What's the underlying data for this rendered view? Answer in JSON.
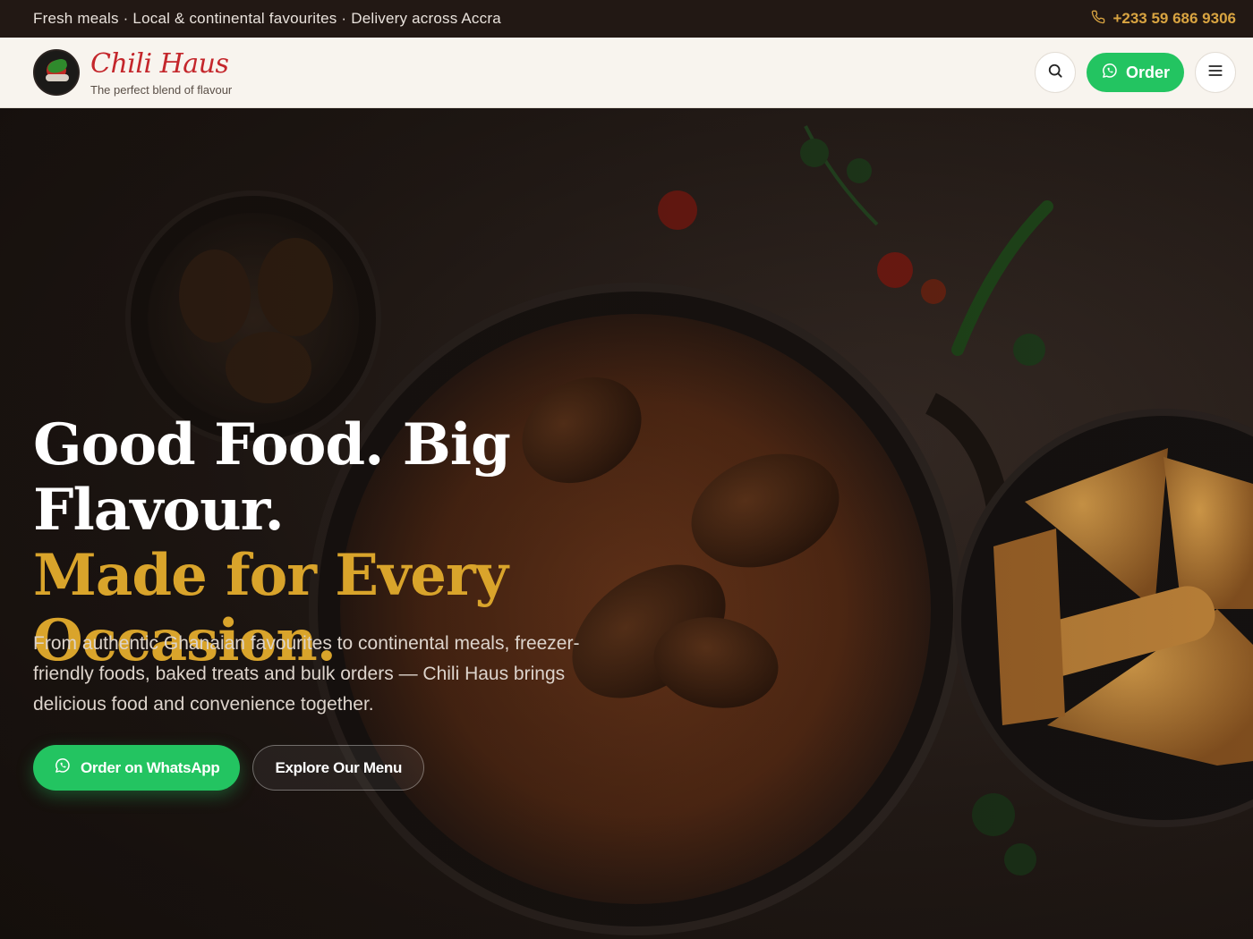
{
  "topbar": {
    "tagline": "Fresh meals · Local & continental favourites · Delivery across Accra",
    "phone": "+233 59 686 9306"
  },
  "header": {
    "brand_name": "Chili Haus",
    "brand_tagline": "The perfect blend of flavour",
    "order_label": "Order"
  },
  "hero": {
    "title_line1": "Good Food. Big Flavour.",
    "title_line2": "Made for Every",
    "title_line3": "Occasion.",
    "description": "From authentic Ghanaian favourites to continental meals, freezer-friendly foods, baked treats and bulk orders — Chili Haus brings delicious food and convenience together.",
    "primary_button": "Order on WhatsApp",
    "secondary_button": "Explore Our Menu"
  },
  "colors": {
    "accent_green": "#23c461",
    "accent_gold": "#d9a42b",
    "brand_red": "#c4262b",
    "dark_bg": "#221814"
  },
  "icons": {
    "phone": "phone-icon",
    "search": "search-icon",
    "whatsapp": "whatsapp-icon",
    "menu": "hamburger-menu-icon"
  }
}
